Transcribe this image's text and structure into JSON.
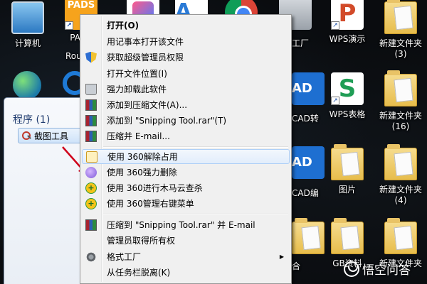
{
  "desktop": {
    "icons": [
      {
        "label": "计算机",
        "icon": "computer-icon"
      },
      {
        "label": "PADS",
        "icon": "pads-icon"
      },
      {
        "label": "Rou",
        "icon": "pads-icon"
      },
      {
        "label": "工厂",
        "icon": "app-icon"
      },
      {
        "label": "WPS演示",
        "icon": "wps-presentation-icon"
      },
      {
        "label": "新建文件夹",
        "sublabel": "(3)",
        "icon": "folder-icon"
      },
      {
        "label": "CAD转",
        "icon": "cad-icon"
      },
      {
        "label": "WPS表格",
        "icon": "wps-spreadsheet-icon"
      },
      {
        "label": "新建文件夹",
        "sublabel": "(16)",
        "icon": "folder-icon"
      },
      {
        "label": "CAD编",
        "icon": "cad-icon"
      },
      {
        "label": "图片",
        "icon": "folder-icon"
      },
      {
        "label": "新建文件夹",
        "sublabel": "(4)",
        "icon": "folder-icon"
      },
      {
        "label": "合",
        "icon": "folder-icon"
      },
      {
        "label": "GB资料",
        "icon": "folder-icon"
      },
      {
        "label": "新建文件夹",
        "icon": "folder-icon"
      }
    ]
  },
  "start_menu": {
    "section_title": "程序 (1)",
    "result_label": "截图工具"
  },
  "context_menu": {
    "items": [
      {
        "label": "打开(O)",
        "bold": true,
        "icon": "none"
      },
      {
        "label": "用记事本打开该文件",
        "icon": "none"
      },
      {
        "label": "获取超级管理员权限",
        "icon": "uac-shield-icon"
      },
      {
        "label": "打开文件位置(I)",
        "icon": "none"
      },
      {
        "label": "强力卸载此软件",
        "icon": "recycle-bin-icon"
      },
      {
        "label": "添加到压缩文件(A)...",
        "icon": "winrar-icon"
      },
      {
        "label": "添加到 \"Snipping Tool.rar\"(T)",
        "icon": "winrar-icon"
      },
      {
        "label": "压缩并 E-mail...",
        "icon": "winrar-icon"
      },
      {
        "label": "使用 360解除占用",
        "icon": "unlock-360-icon",
        "highlighted": true
      },
      {
        "label": "使用 360强力删除",
        "icon": "shred-360-icon"
      },
      {
        "label": "使用 360进行木马云查杀",
        "icon": "scan-360-icon"
      },
      {
        "label": "使用 360管理右键菜单",
        "icon": "menu-360-icon"
      },
      {
        "label": "压缩到 \"Snipping Tool.rar\" 并 E-mail",
        "icon": "winrar-icon"
      },
      {
        "label": "管理员取得所有权",
        "icon": "none"
      },
      {
        "label": "格式工厂",
        "icon": "format-factory-icon",
        "submenu": true
      },
      {
        "label": "从任务栏脱离(K)",
        "icon": "none"
      }
    ]
  },
  "watermark": {
    "text": "悟空问答"
  },
  "colors": {
    "menu_bg": "#f0f0f0",
    "highlight_border": "#aecff7",
    "annotation_arrow": "#d0021b",
    "start_title": "#1e3a6e"
  }
}
